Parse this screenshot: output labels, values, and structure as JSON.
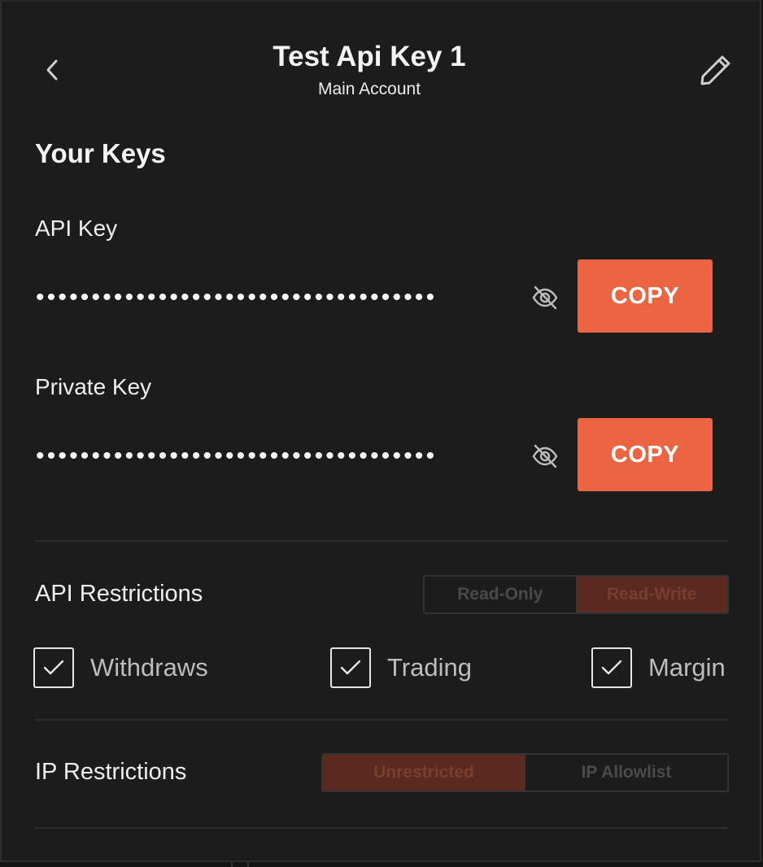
{
  "header": {
    "title": "Test Api Key 1",
    "subtitle": "Main Account",
    "back_icon": "chevron-left-icon",
    "edit_icon": "pencil-icon"
  },
  "keys": {
    "section_title": "Your Keys",
    "api_key": {
      "label": "API Key",
      "masked_value": "••••••••••••••••••••••••••••••••••••",
      "visibility_icon": "eye-off-icon",
      "copy_label": "COPY"
    },
    "private_key": {
      "label": "Private Key",
      "masked_value": "••••••••••••••••••••••••••••••••••••",
      "visibility_icon": "eye-off-icon",
      "copy_label": "COPY"
    }
  },
  "api_restrictions": {
    "label": "API Restrictions",
    "options": [
      "Read-Only",
      "Read-Write"
    ],
    "selected": "Read-Write",
    "permissions": [
      {
        "label": "Withdraws",
        "checked": true
      },
      {
        "label": "Trading",
        "checked": true
      },
      {
        "label": "Margin",
        "checked": true
      }
    ]
  },
  "ip_restrictions": {
    "label": "IP Restrictions",
    "options": [
      "Unrestricted",
      "IP Allowlist"
    ],
    "selected": "Unrestricted"
  },
  "colors": {
    "accent": "#ec6543",
    "background": "#1c1c1c",
    "active_segment": "#5a2a20"
  }
}
